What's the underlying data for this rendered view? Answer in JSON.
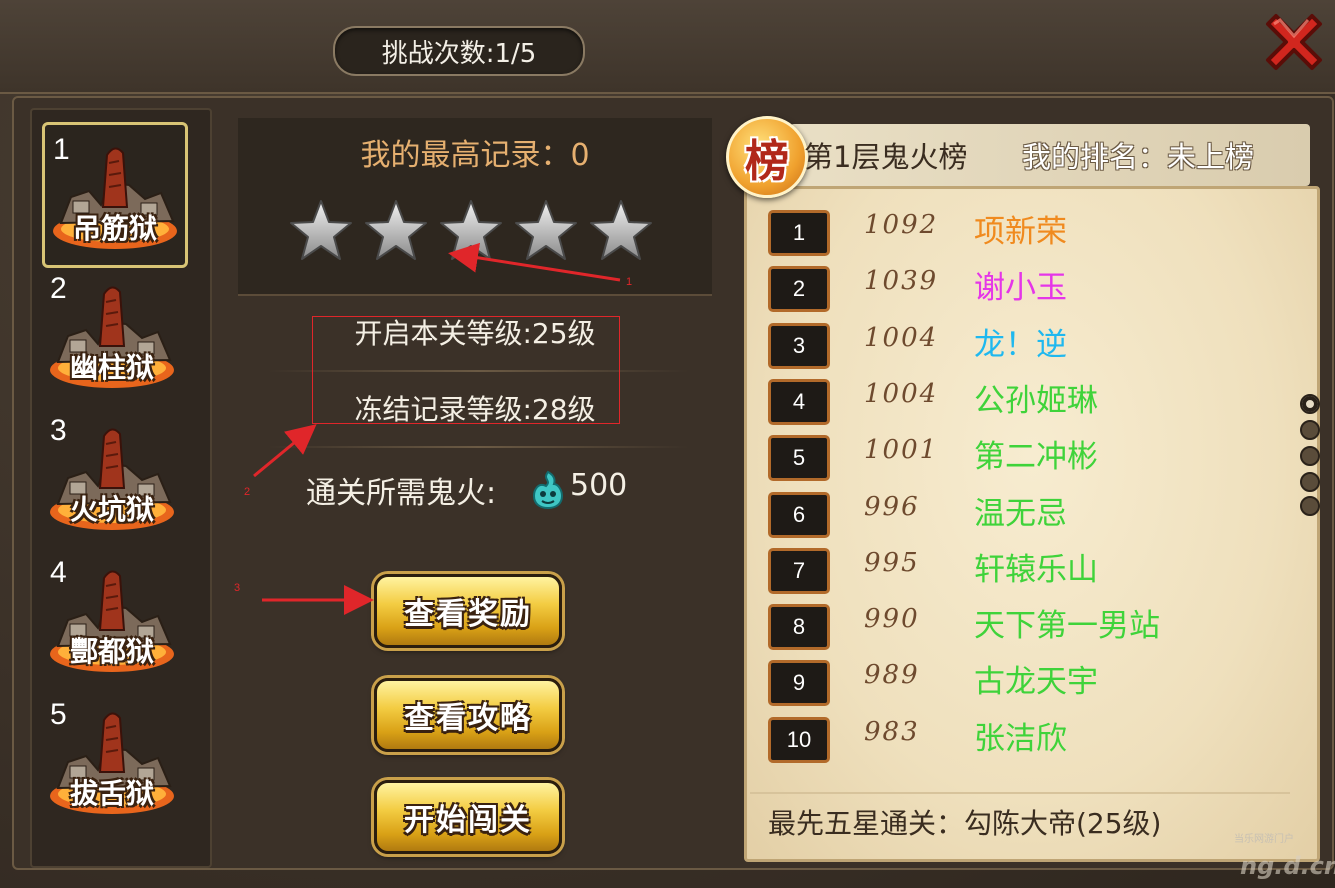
{
  "header": {
    "challenge_count": "挑战次数:1/5"
  },
  "stages": [
    {
      "num": "1",
      "name": "吊筋狱",
      "selected": true
    },
    {
      "num": "2",
      "name": "幽柱狱",
      "selected": false
    },
    {
      "num": "3",
      "name": "火坑狱",
      "selected": false
    },
    {
      "num": "4",
      "name": "酆都狱",
      "selected": false
    },
    {
      "num": "5",
      "name": "拔舌狱",
      "selected": false
    }
  ],
  "detail": {
    "best_record": "我的最高记录：0",
    "stars_earned": 0,
    "stars_total": 5,
    "unlock_level": "开启本关等级:25级",
    "freeze_level": "冻结记录等级:28级",
    "ghost_fire_label": "通关所需鬼火:",
    "ghost_fire_value": "500",
    "btn_reward": "查看奖励",
    "btn_guide": "查看攻略",
    "btn_start": "开始闯关"
  },
  "annotations": {
    "a1": "1",
    "a2": "2",
    "a3": "3"
  },
  "ranking": {
    "badge": "榜",
    "title": "第1层鬼火榜",
    "my_rank": "我的排名：未上榜",
    "rows": [
      {
        "rank": "1",
        "score": "1092",
        "name": "项新荣",
        "color": "#f08a1e"
      },
      {
        "rank": "2",
        "score": "1039",
        "name": "谢小玉",
        "color": "#e536e8"
      },
      {
        "rank": "3",
        "score": "1004",
        "name": "龙！逆",
        "color": "#1fb8ef"
      },
      {
        "rank": "4",
        "score": "1004",
        "name": "公孙姬琳",
        "color": "#3fd33a"
      },
      {
        "rank": "5",
        "score": "1001",
        "name": "第二冲彬",
        "color": "#3fd33a"
      },
      {
        "rank": "6",
        "score": "996",
        "name": "温无忌",
        "color": "#3fd33a"
      },
      {
        "rank": "7",
        "score": "995",
        "name": "轩辕乐山",
        "color": "#3fd33a"
      },
      {
        "rank": "8",
        "score": "990",
        "name": "天下第一男站",
        "color": "#3fd33a"
      },
      {
        "rank": "9",
        "score": "989",
        "name": "古龙天宇",
        "color": "#3fd33a"
      },
      {
        "rank": "10",
        "score": "983",
        "name": "张洁欣",
        "color": "#3fd33a"
      }
    ],
    "first_clear": "最先五星通关：勾陈大帝(25级)"
  },
  "watermark": {
    "small": "当乐网游门户",
    "large": "ng.d.cn"
  }
}
